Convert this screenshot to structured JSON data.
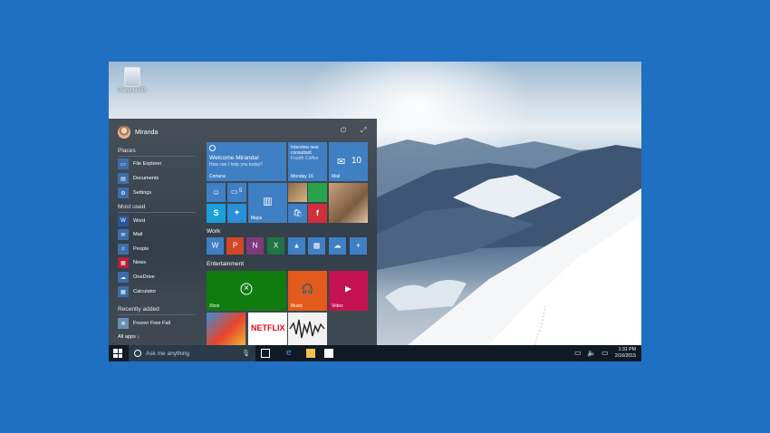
{
  "desktop": {
    "recycle_bin_label": "Recycle Bin"
  },
  "start_menu": {
    "user_name": "Miranda",
    "places_heading": "Places",
    "places": [
      {
        "label": "File Explorer",
        "icon": "folder-icon"
      },
      {
        "label": "Documents",
        "icon": "documents-icon"
      },
      {
        "label": "Settings",
        "icon": "gear-icon"
      }
    ],
    "most_used_heading": "Most used",
    "most_used": [
      {
        "label": "Word",
        "icon": "word-icon"
      },
      {
        "label": "Mail",
        "icon": "mail-icon"
      },
      {
        "label": "People",
        "icon": "people-icon"
      },
      {
        "label": "News",
        "icon": "news-icon"
      },
      {
        "label": "OneDrive",
        "icon": "onedrive-icon"
      },
      {
        "label": "Calculator",
        "icon": "calculator-icon"
      }
    ],
    "recently_added_heading": "Recently added",
    "recently_added": [
      {
        "label": "Frozen Free Fall",
        "icon": "game-icon"
      }
    ],
    "all_apps_label": "All apps",
    "tiles": {
      "cortana": {
        "title": "Welcome Miranda!",
        "subtitle": "How can I help you today?",
        "label": "Cortana"
      },
      "calendar": {
        "line1": "Interview new",
        "line2": "consultant",
        "line3": "Fourth Coffee",
        "date": "Monday 16"
      },
      "mail": {
        "count": "10",
        "label": "Mail"
      },
      "people_badge": "5",
      "maps_label": "Maps",
      "work_heading": "Work",
      "entertainment_heading": "Entertainment",
      "xbox_label": "Xbox",
      "music_label": "Music",
      "video_label": "Video",
      "netflix_label": "NETFLIX"
    }
  },
  "taskbar": {
    "search_placeholder": "Ask me anything",
    "time": "1:31 PM",
    "date": "2/16/2015"
  },
  "colors": {
    "desktop_bg": "#1f6fc2",
    "tile_blue": "#3f7fc4",
    "xbox_green": "#107c10",
    "music_orange": "#e25a1c",
    "video_red": "#c3124f"
  }
}
